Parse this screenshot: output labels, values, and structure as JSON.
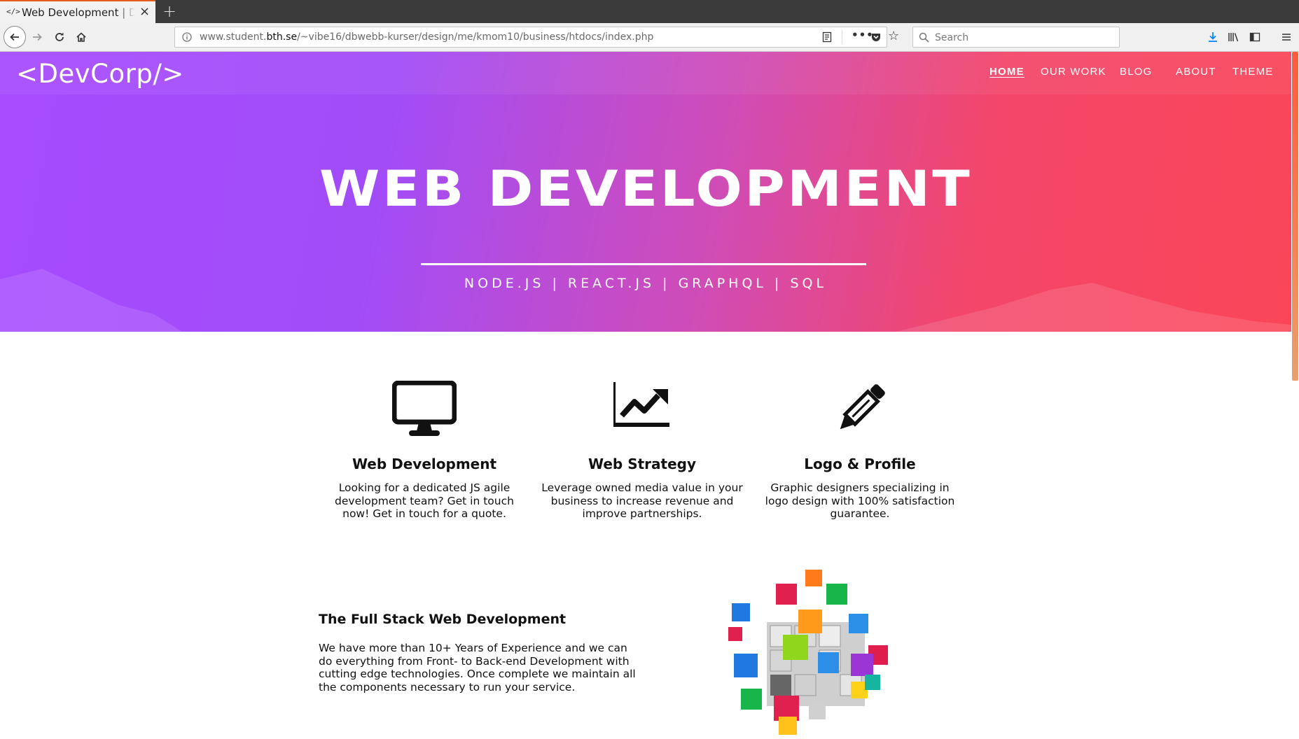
{
  "browser": {
    "tab_title": "Web Development | DevCorp",
    "tab_favicon": "</>",
    "new_tab_label": "+",
    "url_prefix": "www.student.",
    "url_domain": "bth.se",
    "url_path": "/~vibe16/dbwebb-kurser/design/me/kmom10/business/htdocs/index.php",
    "more_label": "•••",
    "search_placeholder": "Search"
  },
  "site": {
    "logo": "<DevCorp/>",
    "nav": {
      "home": "HOME",
      "our_work": "OUR WORK",
      "blog": "BLOG",
      "about": "ABOUT",
      "theme": "THEME"
    },
    "hero": {
      "title": "WEB DEVELOPMENT",
      "subtitle": "NODE.JS | REACT.JS | GRAPHQL | SQL"
    },
    "services": [
      {
        "icon": "monitor-icon",
        "title": "Web Development",
        "text": "Looking for a dedicated JS agile development team? Get in touch now! Get in touch for a quote."
      },
      {
        "icon": "chart-line-icon",
        "title": "Web Strategy",
        "text": "Leverage owned media value in your business to increase revenue and improve partnerships."
      },
      {
        "icon": "pencil-icon",
        "title": "Logo & Profile",
        "text": "Graphic designers specializing in logo design with 100% satisfaction guarantee."
      }
    ],
    "fullstack": {
      "title": "The Full Stack Web Development",
      "text": "We have more than 10+ Years of Experience and we can do everything from Front- to Back-end Development with cutting edge technologies. Once complete we maintain all the components necessary to run your service."
    }
  },
  "colors": {
    "hero_start": "#a64bff",
    "hero_end": "#fb4658",
    "tab_accent": "#e25a1c",
    "download_icon": "#0a84ff"
  }
}
